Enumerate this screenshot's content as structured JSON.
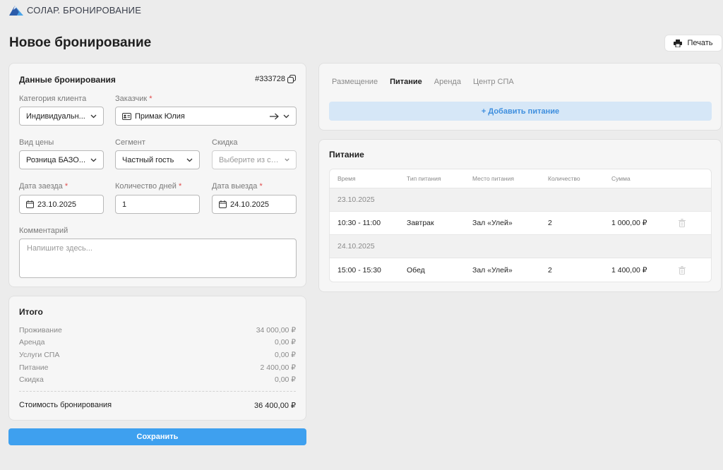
{
  "brand": {
    "name": "СОЛАР. БРОНИРОВАНИЕ",
    "logo_icon": "mountain-logo-icon"
  },
  "header": {
    "title": "Новое бронирование",
    "print_label": "Печать"
  },
  "booking": {
    "title": "Данные бронирования",
    "number": "#333728",
    "client_category": {
      "label": "Категория клиента",
      "value": "Индивидуальн..."
    },
    "customer": {
      "label": "Заказчик",
      "required_mark": "*",
      "value": "Примак Юлия"
    },
    "price_type": {
      "label": "Вид цены",
      "value": "Розница БАЗО..."
    },
    "segment": {
      "label": "Сегмент",
      "value": "Частный гость"
    },
    "discount": {
      "label": "Скидка",
      "placeholder": "Выберите из списка"
    },
    "checkin": {
      "label": "Дата заезда",
      "required_mark": "*",
      "value": "23.10.2025"
    },
    "days": {
      "label": "Количество дней",
      "required_mark": "*",
      "value": "1"
    },
    "checkout": {
      "label": "Дата выезда",
      "required_mark": "*",
      "value": "24.10.2025"
    },
    "comment": {
      "label": "Комментарий",
      "placeholder": "Напишите здесь..."
    }
  },
  "summary": {
    "title": "Итого",
    "rows": [
      {
        "label": "Проживание",
        "value": "34 000,00 ₽"
      },
      {
        "label": "Аренда",
        "value": "0,00 ₽"
      },
      {
        "label": "Услуги СПА",
        "value": "0,00 ₽"
      },
      {
        "label": "Питание",
        "value": "2 400,00 ₽"
      },
      {
        "label": "Скидка",
        "value": "0,00 ₽"
      }
    ],
    "total_label": "Стоимость бронирования",
    "total_value": "36 400,00 ₽",
    "save_label": "Сохранить"
  },
  "tabs": [
    {
      "label": "Размещение",
      "active": false
    },
    {
      "label": "Питание",
      "active": true
    },
    {
      "label": "Аренда",
      "active": false
    },
    {
      "label": "Центр СПА",
      "active": false
    }
  ],
  "add_meal_label": "+ Добавить питание",
  "meals": {
    "title": "Питание",
    "columns": [
      "Время",
      "Тип питания",
      "Место питания",
      "Количество",
      "Сумма"
    ],
    "groups": [
      {
        "date": "23.10.2025",
        "rows": [
          {
            "time": "10:30 - 11:00",
            "type": "Завтрак",
            "place": "Зал «Улей»",
            "qty": "2",
            "sum": "1 000,00 ₽"
          }
        ]
      },
      {
        "date": "24.10.2025",
        "rows": [
          {
            "time": "15:00 - 15:30",
            "type": "Обед",
            "place": "Зал «Улей»",
            "qty": "2",
            "sum": "1 400,00 ₽"
          }
        ]
      }
    ]
  },
  "colors": {
    "accent": "#3ea0ef",
    "add_bg": "#d6e7f7",
    "required": "#e04a4a"
  }
}
